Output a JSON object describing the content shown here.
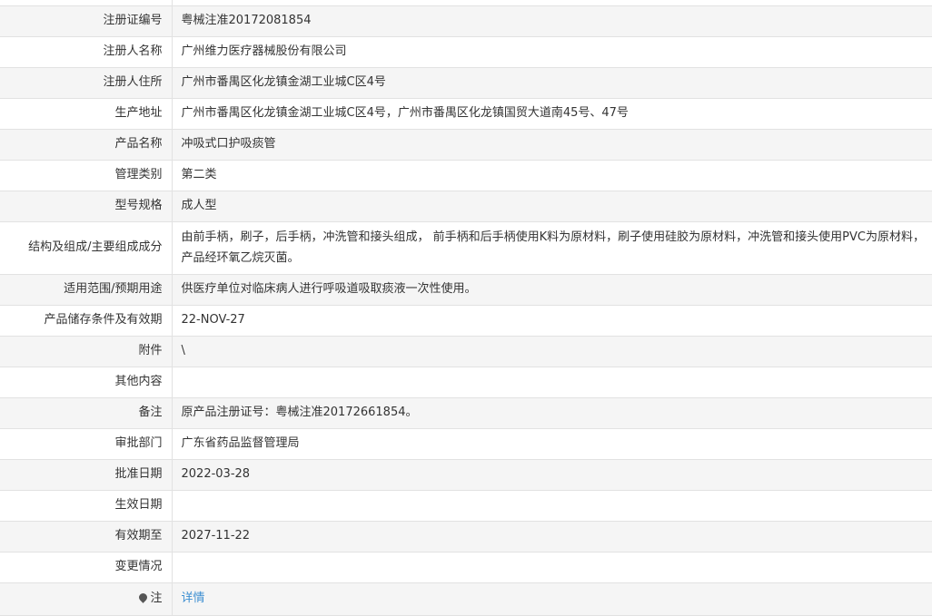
{
  "rows": [
    {
      "label": "注册证编号",
      "value": "粤械注准20172081854"
    },
    {
      "label": "注册人名称",
      "value": "广州维力医疗器械股份有限公司"
    },
    {
      "label": "注册人住所",
      "value": "广州市番禺区化龙镇金湖工业城C区4号"
    },
    {
      "label": "生产地址",
      "value": "广州市番禺区化龙镇金湖工业城C区4号，广州市番禺区化龙镇国贸大道南45号、47号"
    },
    {
      "label": "产品名称",
      "value": "冲吸式口护吸痰管"
    },
    {
      "label": "管理类别",
      "value": "第二类"
    },
    {
      "label": "型号规格",
      "value": "成人型"
    },
    {
      "label": "结构及组成/主要组成成分",
      "value": "由前手柄，刷子，后手柄，冲洗管和接头组成， 前手柄和后手柄使用K料为原材料，刷子使用硅胶为原材料，冲洗管和接头使用PVC为原材料，产品经环氧乙烷灭菌。"
    },
    {
      "label": "适用范围/预期用途",
      "value": "供医疗单位对临床病人进行呼吸道吸取痰液一次性使用。"
    },
    {
      "label": "产品储存条件及有效期",
      "value": "22-NOV-27"
    },
    {
      "label": "附件",
      "value": "\\"
    },
    {
      "label": "其他内容",
      "value": ""
    },
    {
      "label": "备注",
      "value": "原产品注册证号：粤械注准20172661854。"
    },
    {
      "label": "审批部门",
      "value": "广东省药品监督管理局"
    },
    {
      "label": "批准日期",
      "value": "2022-03-28"
    },
    {
      "label": "生效日期",
      "value": ""
    },
    {
      "label": "有效期至",
      "value": "2027-11-22"
    },
    {
      "label": "变更情况",
      "value": ""
    }
  ],
  "note": {
    "label": "注",
    "icon": "pin-icon",
    "link_text": "详情"
  },
  "colors": {
    "border": "#e2e2e2",
    "stripe": "#f5f5f5",
    "link": "#3d8fd1",
    "text": "#333333"
  }
}
